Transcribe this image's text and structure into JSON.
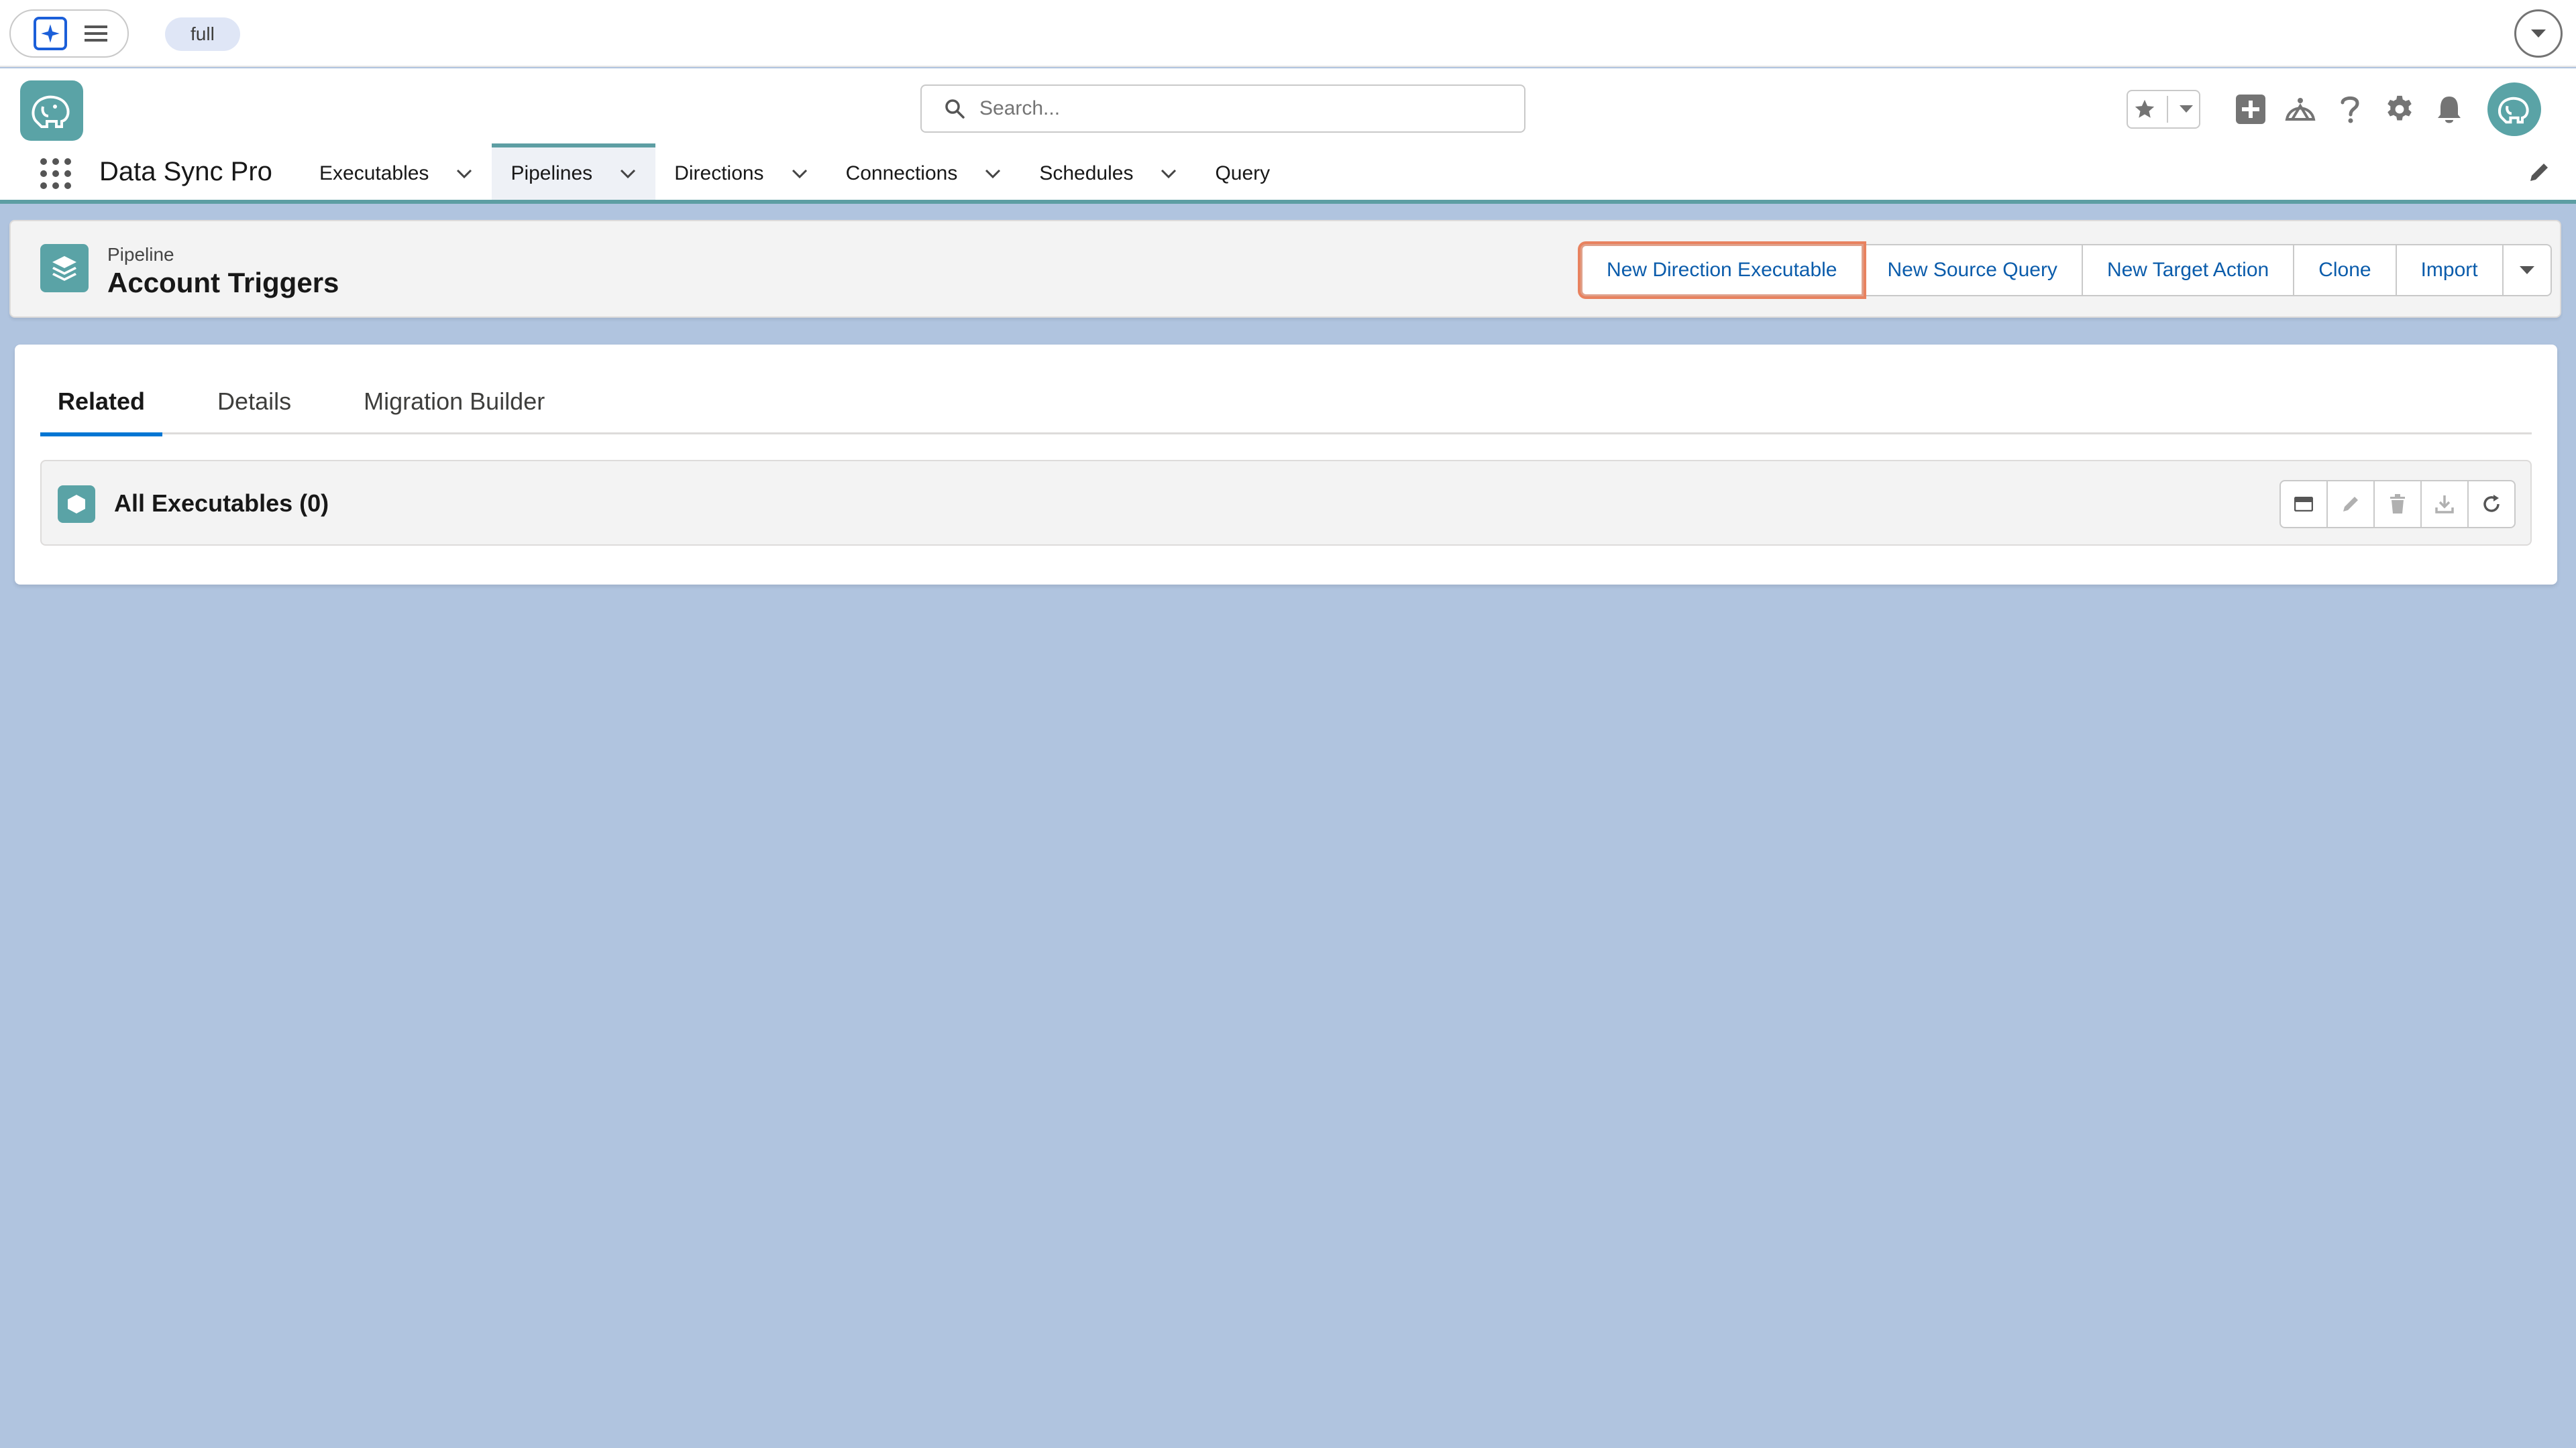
{
  "utility_bar": {
    "env_badge": "full"
  },
  "header": {
    "search_placeholder": "Search...",
    "app_name": "Data Sync Pro"
  },
  "nav": {
    "items": [
      {
        "label": "Executables",
        "has_menu": true,
        "active": false
      },
      {
        "label": "Pipelines",
        "has_menu": true,
        "active": true
      },
      {
        "label": "Directions",
        "has_menu": true,
        "active": false
      },
      {
        "label": "Connections",
        "has_menu": true,
        "active": false
      },
      {
        "label": "Schedules",
        "has_menu": true,
        "active": false
      },
      {
        "label": "Query",
        "has_menu": false,
        "active": false
      }
    ]
  },
  "record": {
    "type": "Pipeline",
    "title": "Account Triggers",
    "actions": [
      "New Direction Executable",
      "New Source Query",
      "New Target Action",
      "Clone",
      "Import"
    ]
  },
  "tabs": [
    "Related",
    "Details",
    "Migration Builder"
  ],
  "related_list": {
    "title": "All Executables (0)"
  },
  "colors": {
    "brand_teal": "#5aa3a6",
    "link_blue": "#0b5cab",
    "tab_active": "#0176d3",
    "page_bg": "#b0c4df",
    "focus_ring": "#e8825f"
  },
  "icons": {
    "app_launcher": "waffle-icon",
    "logo": "elephant-logo",
    "record": "layers-icon",
    "related_list": "cube-icon"
  }
}
